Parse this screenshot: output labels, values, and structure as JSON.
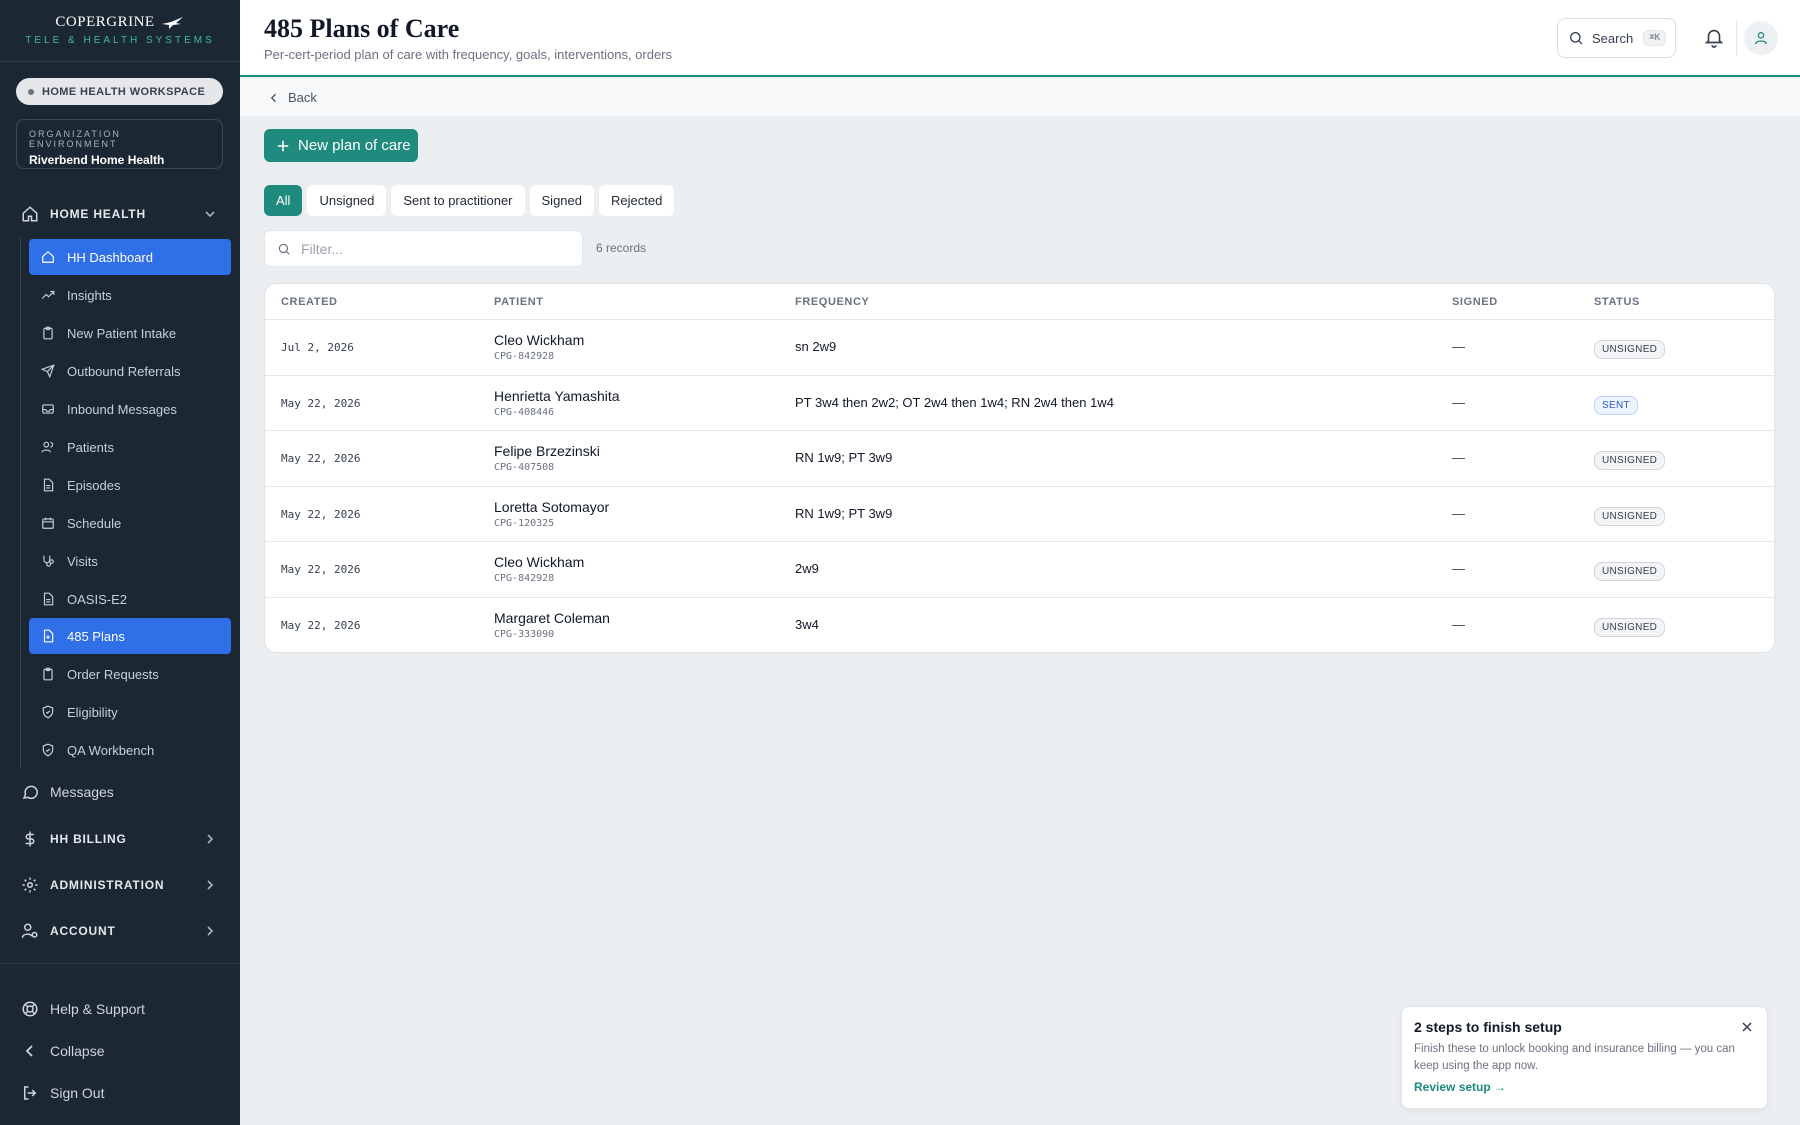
{
  "brand": {
    "name": "COPERGRINE",
    "tagline": "TELE & HEALTH SYSTEMS"
  },
  "workspace": {
    "label": "HOME HEALTH WORKSPACE"
  },
  "org": {
    "label": "ORGANIZATION ENVIRONMENT",
    "name": "Riverbend Home Health"
  },
  "nav": {
    "home_health": "HOME HEALTH",
    "items": [
      {
        "label": "HH Dashboard",
        "icon": "home-icon"
      },
      {
        "label": "Insights",
        "icon": "trend-icon"
      },
      {
        "label": "New Patient Intake",
        "icon": "clipboard-icon"
      },
      {
        "label": "Outbound Referrals",
        "icon": "send-icon"
      },
      {
        "label": "Inbound Messages",
        "icon": "inbox-icon"
      },
      {
        "label": "Patients",
        "icon": "users-icon"
      },
      {
        "label": "Episodes",
        "icon": "file-icon"
      },
      {
        "label": "Schedule",
        "icon": "calendar-icon"
      },
      {
        "label": "Visits",
        "icon": "stethoscope-icon"
      },
      {
        "label": "OASIS-E2",
        "icon": "file-icon"
      },
      {
        "label": "485 Plans",
        "icon": "file-medical-icon"
      },
      {
        "label": "Order Requests",
        "icon": "clipboard-icon"
      },
      {
        "label": "Eligibility",
        "icon": "shield-icon"
      },
      {
        "label": "QA Workbench",
        "icon": "shield-icon"
      }
    ],
    "messages": "Messages",
    "hh_billing": "HH BILLING",
    "administration": "ADMINISTRATION",
    "account": "ACCOUNT",
    "help": "Help & Support",
    "collapse": "Collapse",
    "sign_out": "Sign Out"
  },
  "header": {
    "title": "485 Plans of Care",
    "subtitle": "Per-cert-period plan of care with frequency, goals, interventions, orders",
    "search_label": "Search",
    "search_shortcut": "⌘K"
  },
  "back": "Back",
  "new_button": "New plan of care",
  "tabs": [
    "All",
    "Unsigned",
    "Sent to practitioner",
    "Signed",
    "Rejected"
  ],
  "filter": {
    "placeholder": "Filter..."
  },
  "records": "6 records",
  "table": {
    "columns": {
      "created": "CREATED",
      "patient": "PATIENT",
      "frequency": "FREQUENCY",
      "signed": "SIGNED",
      "status": "STATUS"
    },
    "rows": [
      {
        "created": "Jul 2, 2026",
        "name": "Cleo Wickham",
        "id": "CPG-842928",
        "frequency": "sn 2w9",
        "signed": "—",
        "status": "UNSIGNED"
      },
      {
        "created": "May 22, 2026",
        "name": "Henrietta Yamashita",
        "id": "CPG-408446",
        "frequency": "PT 3w4 then 2w2; OT 2w4 then 1w4; RN 2w4 then 1w4",
        "signed": "—",
        "status": "SENT"
      },
      {
        "created": "May 22, 2026",
        "name": "Felipe Brzezinski",
        "id": "CPG-407508",
        "frequency": "RN 1w9; PT 3w9",
        "signed": "—",
        "status": "UNSIGNED"
      },
      {
        "created": "May 22, 2026",
        "name": "Loretta Sotomayor",
        "id": "CPG-120325",
        "frequency": "RN 1w9; PT 3w9",
        "signed": "—",
        "status": "UNSIGNED"
      },
      {
        "created": "May 22, 2026",
        "name": "Cleo Wickham",
        "id": "CPG-842928",
        "frequency": "2w9",
        "signed": "—",
        "status": "UNSIGNED"
      },
      {
        "created": "May 22, 2026",
        "name": "Margaret Coleman",
        "id": "CPG-333090",
        "frequency": "3w4",
        "signed": "—",
        "status": "UNSIGNED"
      }
    ]
  },
  "toast": {
    "title": "2 steps to finish setup",
    "body": "Finish these to unlock booking and insurance billing — you can keep using the app now.",
    "link": "Review setup →"
  },
  "colors": {
    "accent": "#1f8a7e",
    "sidebar": "#1b2733",
    "active_nav": "#2f6fe8"
  }
}
